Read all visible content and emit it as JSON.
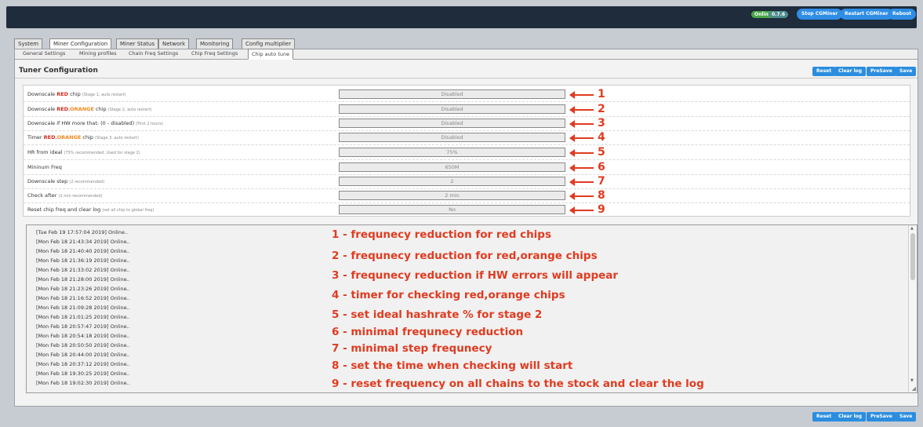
{
  "header": {
    "status_online": "Online",
    "status_version": "0.7.6",
    "buttons": {
      "stop": "Stop CGMiner",
      "restart": "Restart CGMiner",
      "reboot": "Reboot"
    }
  },
  "main_tabs": [
    "System",
    "Miner Configuration",
    "Miner Status",
    "Network",
    "Monitoring",
    "Config multiplier"
  ],
  "sub_tabs": [
    "General Settings",
    "Mining profiles",
    "Chain Freq Settings",
    "Chip Freq Settings",
    "Chip auto tune"
  ],
  "section_title": "Tuner Configuration",
  "actions": {
    "reset": "Reset",
    "clear_log": "Clear log",
    "presave": "PreSave",
    "save": "Save"
  },
  "settings": [
    {
      "pre": "Downscale ",
      "red": "RED",
      "sep": "",
      "orange": "",
      "post": " chip",
      "hint": "(Stage 1, auto restart)",
      "value": "Disabled",
      "num": "1"
    },
    {
      "pre": "Downscale ",
      "red": "RED",
      "sep": ",",
      "orange": "ORANGE",
      "post": " chip",
      "hint": "(Stage 2, auto restart)",
      "value": "Disabled",
      "num": "2"
    },
    {
      "pre": "Downscale if HW more that: (0 - disabled)",
      "red": "",
      "sep": "",
      "orange": "",
      "post": "",
      "hint": "(First 2 hours)",
      "value": "Disabled",
      "num": "3"
    },
    {
      "pre": "Timer ",
      "red": "RED",
      "sep": ",",
      "orange": "ORANGE",
      "post": " chip",
      "hint": "(Stage 3, auto restart)",
      "value": "Disabled",
      "num": "4"
    },
    {
      "pre": "HR from ideal",
      "red": "",
      "sep": "",
      "orange": "",
      "post": "",
      "hint": "(75% recommended. Used for stage 2)",
      "value": "75%",
      "num": "5"
    },
    {
      "pre": "Mininum Freq",
      "red": "",
      "sep": "",
      "orange": "",
      "post": "",
      "hint": "",
      "value": "650M",
      "num": "6"
    },
    {
      "pre": "Downscale step",
      "red": "",
      "sep": "",
      "orange": "",
      "post": "",
      "hint": "(2 recommended)",
      "value": "2",
      "num": "7"
    },
    {
      "pre": "Check after",
      "red": "",
      "sep": "",
      "orange": "",
      "post": "",
      "hint": "(2 min recommended)",
      "value": "2 min",
      "num": "8"
    },
    {
      "pre": "Reset chip freq and clear log",
      "red": "",
      "sep": "",
      "orange": "",
      "post": "",
      "hint": "(set all chip to global freq)",
      "value": "No",
      "num": "9"
    }
  ],
  "log": [
    "[Tue Feb 19 17:57:04 2019] Online..",
    "[Mon Feb 18 21:43:34 2019] Online..",
    "[Mon Feb 18 21:40:40 2019] Online..",
    "[Mon Feb 18 21:36:19 2019] Online..",
    "[Mon Feb 18 21:33:02 2019] Online..",
    "[Mon Feb 18 21:28:00 2019] Online..",
    "[Mon Feb 18 21:23:26 2019] Online..",
    "[Mon Feb 18 21:16:52 2019] Online..",
    "[Mon Feb 18 21:09:28 2019] Online..",
    "[Mon Feb 18 21:01:25 2019] Online..",
    "[Mon Feb 18 20:57:47 2019] Online..",
    "[Mon Feb 18 20:54:18 2019] Online..",
    "[Mon Feb 18 20:50:50 2019] Online..",
    "[Mon Feb 18 20:44:00 2019] Online..",
    "[Mon Feb 18 20:37:12 2019] Online..",
    "[Mon Feb 18 19:30:25 2019] Online..",
    "[Mon Feb 18 19:02:30 2019] Online.."
  ],
  "annotations": [
    "1 - frequnecy reduction for red chips",
    "2 - frequnecy reduction for red,orange chips",
    "3 - frequnecy reduction if HW errors will appear",
    "4 - timer for checking red,orange chips",
    "5 - set ideal hashrate % for stage 2",
    "6 - minimal frequnecy reduction",
    "7 - minimal step frequnecy",
    "8 - set the time when checking will start",
    "9 - reset frequency on all chains to the stock and clear the log"
  ],
  "colors": {
    "accent": "#2b8de0",
    "annotation": "#e03b20",
    "red_label": "#d62a20",
    "orange_label": "#f08a1c"
  }
}
